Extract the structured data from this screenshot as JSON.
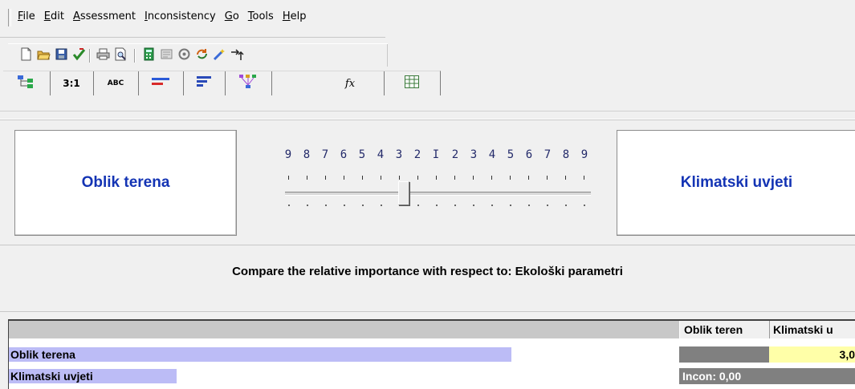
{
  "menu": {
    "items": [
      {
        "mnemonic": "F",
        "rest": "ile"
      },
      {
        "mnemonic": "E",
        "rest": "dit"
      },
      {
        "mnemonic": "A",
        "rest": "ssessment"
      },
      {
        "mnemonic": "I",
        "rest": "nconsistency"
      },
      {
        "mnemonic": "G",
        "rest": "o"
      },
      {
        "mnemonic": "T",
        "rest": "ools"
      },
      {
        "mnemonic": "H",
        "rest": "elp"
      }
    ]
  },
  "toolbar": {
    "icons": [
      "new-file-icon",
      "open-folder-icon",
      "save-icon",
      "check-icon",
      "print-icon",
      "print-preview-icon",
      "calculator-icon",
      "document-icon",
      "network-icon",
      "refresh-icon",
      "wand-icon",
      "arrow-icon"
    ]
  },
  "tabs": {
    "labels": [
      "",
      "3:1",
      "ABC",
      "",
      "",
      "",
      "fx",
      ""
    ],
    "icons": [
      "tree-icon",
      "",
      "",
      "bar-chart-icon",
      "horizontal-bars-icon",
      "hierarchy-icon",
      "formula-icon",
      "grid-icon"
    ]
  },
  "compare": {
    "left_node": "Oblik terena",
    "right_node": "Klimatski uvjeti",
    "scale_left": [
      "9",
      "8",
      "7",
      "6",
      "5",
      "4",
      "3",
      "2"
    ],
    "scale_center": "I",
    "scale_right": [
      "2",
      "3",
      "4",
      "5",
      "6",
      "7",
      "8",
      "9"
    ],
    "slider_value": "3",
    "question": "Compare the relative importance with respect to: Ekološki parametri"
  },
  "matrix": {
    "columns": [
      "Oblik teren",
      "Klimatski u"
    ],
    "rows": [
      {
        "label": "Oblik terena",
        "bar_fraction": 0.75,
        "cells": [
          "",
          "3,0"
        ]
      },
      {
        "label": "Klimatski uvjeti",
        "bar_fraction": 0.25,
        "cells": [
          "Incon: 0,00",
          ""
        ]
      }
    ]
  },
  "colors": {
    "node_text": "#1434b4",
    "bar": "#bcbcf6",
    "highlight_cell": "#ffffa8",
    "gray_cell": "#808080",
    "header_band": "#c8c8c8"
  }
}
